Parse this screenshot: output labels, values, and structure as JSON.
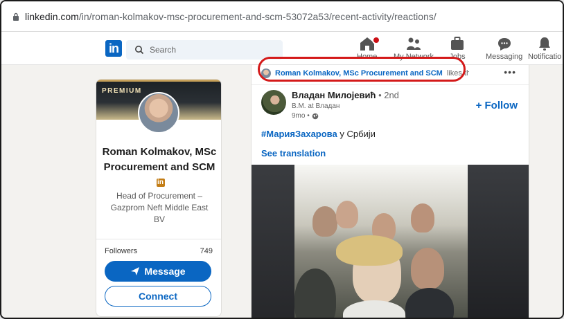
{
  "browser": {
    "url_host": "linkedin.com",
    "url_path": "/in/roman-kolmakov-msc-procurement-and-scm-53072a53/recent-activity/reactions/"
  },
  "nav": {
    "logo": "in",
    "search_placeholder": "Search",
    "items": [
      {
        "label": "Home",
        "icon": "home-icon"
      },
      {
        "label": "My Network",
        "icon": "network-icon"
      },
      {
        "label": "Jobs",
        "icon": "briefcase-icon"
      },
      {
        "label": "Messaging",
        "icon": "messaging-icon"
      },
      {
        "label": "Notificatio",
        "icon": "bell-icon"
      }
    ]
  },
  "profile": {
    "premium_label": "PREMIUM",
    "name": "Roman Kolmakov, MSc Procurement and SCM",
    "headline": "Head of Procurement – Gazprom Neft Middle East BV",
    "followers_label": "Followers",
    "followers_count": "749",
    "message_label": "Message",
    "connect_label": "Connect"
  },
  "post": {
    "liked_by": "Roman Kolmakov, MSc Procurement and SCM",
    "liked_suffix": "likes thi",
    "more_menu": "•••",
    "author_name": "Владан Милојевић",
    "author_degree": "• 2nd",
    "author_title": "B.M. at Владан",
    "time": "9mo •",
    "follow_label": "+ Follow",
    "hashtag": "#МарияЗахарова",
    "text_tail": " у Србији",
    "see_translation": "See translation"
  },
  "colors": {
    "brand": "#0a66c2",
    "highlight": "#d41a1a",
    "premium_gold": "#c7a15a"
  }
}
